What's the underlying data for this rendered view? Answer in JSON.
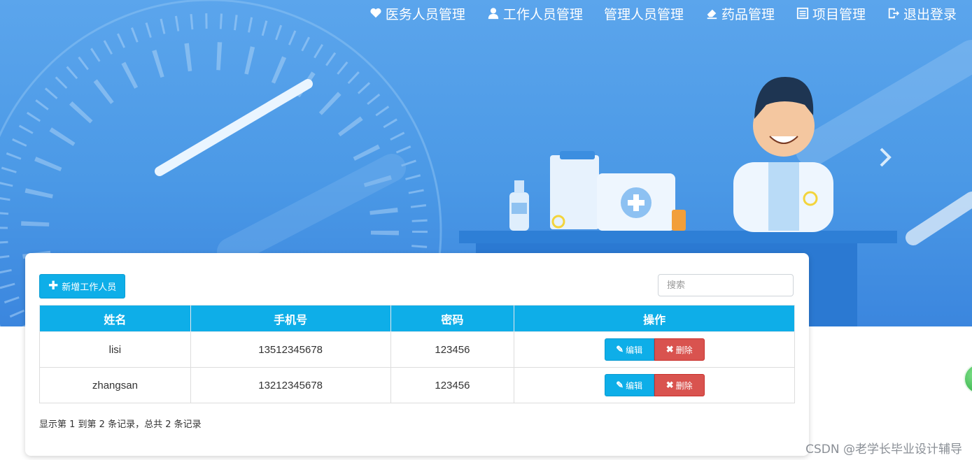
{
  "nav": {
    "items": [
      {
        "label": "医务人员管理",
        "icon": "heart-icon"
      },
      {
        "label": "工作人员管理",
        "icon": "user-icon"
      },
      {
        "label": "管理人员管理",
        "icon": ""
      },
      {
        "label": "药品管理",
        "icon": "eraser-icon"
      },
      {
        "label": "项目管理",
        "icon": "list-icon"
      },
      {
        "label": "退出登录",
        "icon": "logout-icon"
      }
    ]
  },
  "toolbar": {
    "add_label": "新增工作人员",
    "search_placeholder": "搜索"
  },
  "table": {
    "columns": [
      "姓名",
      "手机号",
      "密码",
      "操作"
    ],
    "rows": [
      {
        "name": "lisi",
        "phone": "13512345678",
        "password": "123456"
      },
      {
        "name": "zhangsan",
        "phone": "13212345678",
        "password": "123456"
      }
    ],
    "edit_label": "编辑",
    "delete_label": "删除"
  },
  "pagination": {
    "info": "显示第 1 到第 2 条记录，总共 2 条记录"
  },
  "watermark": "CSDN @老学长毕业设计辅导",
  "colors": {
    "primary": "#0eaee8",
    "danger": "#d9534f",
    "banner": "#4b99e6"
  }
}
